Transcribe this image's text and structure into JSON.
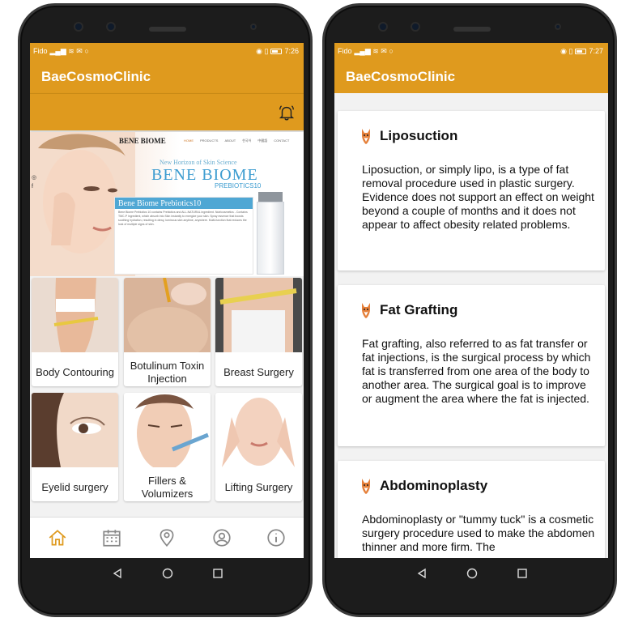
{
  "left_screen": {
    "status": {
      "carrier": "Fido",
      "time": "7:26"
    },
    "app_title": "BaeCosmoClinic",
    "banner": {
      "brand": "BENE BIOME",
      "nav": [
        "HOME",
        "PRODUCTS",
        "ABOUT",
        "한국어",
        "中國語",
        "CONTACT"
      ],
      "horizon": "New Horizon of Skin Science",
      "big_brand": "BENE BIOME",
      "prebiotics": "PREBIOTICS10",
      "box_title": "Bene Biome Prebiotics10",
      "box_text": "Bene Biome Prebiotics 10 contains Prebiotics and ALL-NATURAL ingredient. Nutricosmetics - Contains TMC-P ingredient, which absorb into Skin instantly to energize your skin. Spray essence that boosts soothing hydration, resulting in dewy, luminous skin anytime, anywhere. Multi-function that reduces the look of multiple signs of skin."
    },
    "tiles": [
      {
        "label": "Body Contouring"
      },
      {
        "label": "Botulinum Toxin Injection"
      },
      {
        "label": "Breast Surgery"
      },
      {
        "label": "Eyelid surgery"
      },
      {
        "label": "Fillers & Volumizers"
      },
      {
        "label": "Lifting Surgery"
      }
    ],
    "bottom_nav": [
      "home-icon",
      "calendar-icon",
      "location-icon",
      "profile-icon",
      "info-icon"
    ],
    "accent": "#df9a1e"
  },
  "right_screen": {
    "status": {
      "carrier": "Fido",
      "time": "7:27"
    },
    "app_title": "BaeCosmoClinic",
    "cards": [
      {
        "title": "Liposuction",
        "body": "Liposuction, or simply lipo, is a type of fat removal procedure used in plastic surgery. Evidence does not support an effect on weight beyond a couple of months and it does not appear to affect obesity related problems."
      },
      {
        "title": "Fat Grafting",
        "body": "Fat grafting, also referred to as fat transfer or fat injections, is the surgical process by which fat is transferred from one area of the body to another area. The surgical goal is to improve or augment the area where the fat is injected."
      },
      {
        "title": "Abdominoplasty",
        "body": "Abdominoplasty or \"tummy tuck\" is a cosmetic surgery procedure used to make the abdomen thinner and more firm. The"
      }
    ]
  }
}
